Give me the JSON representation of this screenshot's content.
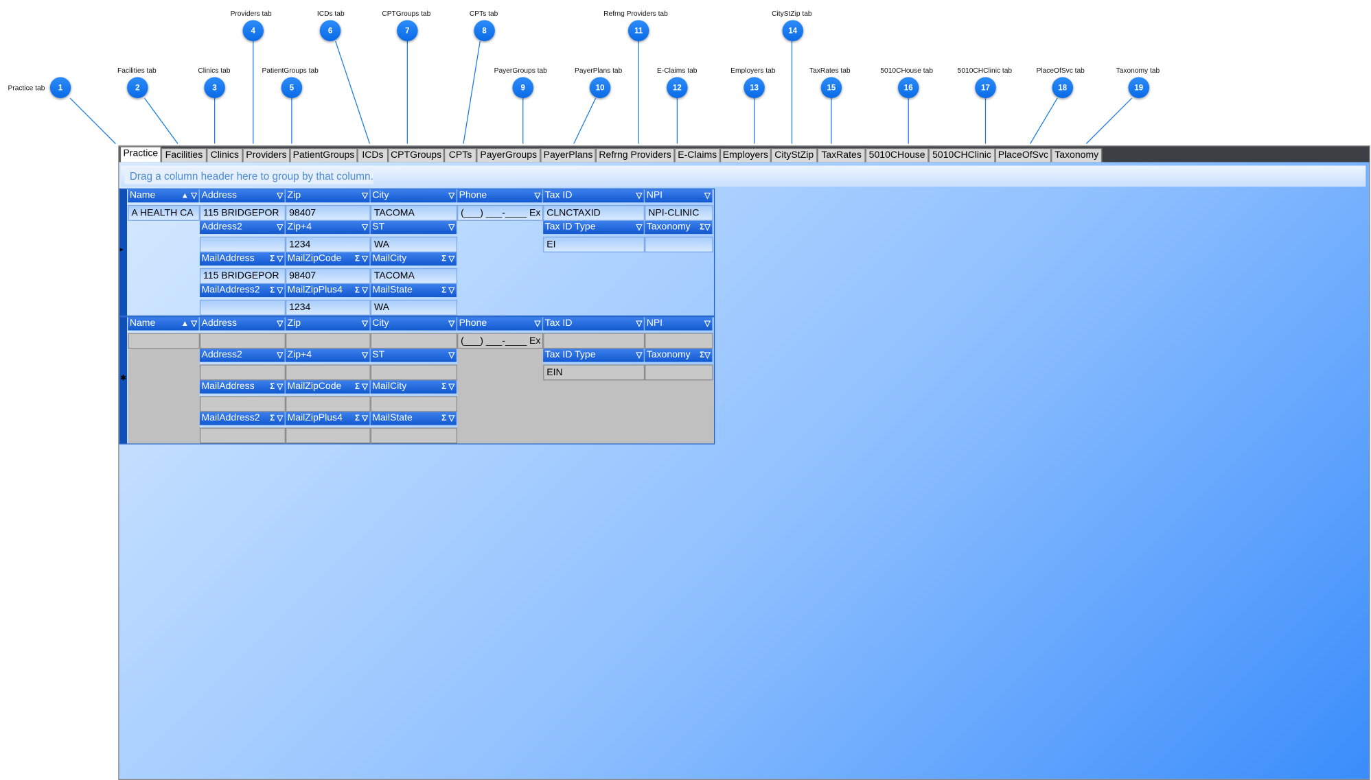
{
  "callouts": [
    {
      "n": "1",
      "label": "Practice tab"
    },
    {
      "n": "2",
      "label": "Facilities tab"
    },
    {
      "n": "3",
      "label": "Clinics tab"
    },
    {
      "n": "4",
      "label": "Providers tab"
    },
    {
      "n": "5",
      "label": "PatientGroups tab"
    },
    {
      "n": "6",
      "label": "ICDs tab"
    },
    {
      "n": "7",
      "label": "CPTGroups tab"
    },
    {
      "n": "8",
      "label": "CPTs tab"
    },
    {
      "n": "9",
      "label": "PayerGroups tab"
    },
    {
      "n": "10",
      "label": "PayerPlans tab"
    },
    {
      "n": "11",
      "label": "Refrng Providers tab"
    },
    {
      "n": "12",
      "label": "E-Claims tab"
    },
    {
      "n": "13",
      "label": "Employers tab"
    },
    {
      "n": "14",
      "label": "CityStZip tab"
    },
    {
      "n": "15",
      "label": "TaxRates tab"
    },
    {
      "n": "16",
      "label": "5010CHouse tab"
    },
    {
      "n": "17",
      "label": "5010CHClinic tab"
    },
    {
      "n": "18",
      "label": "PlaceOfSvc tab"
    },
    {
      "n": "19",
      "label": "Taxonomy tab"
    }
  ],
  "tabs": [
    "Practice",
    "Facilities",
    "Clinics",
    "Providers",
    "PatientGroups",
    "ICDs",
    "CPTGroups",
    "CPTs",
    "PayerGroups",
    "PayerPlans",
    "Refrng Providers",
    "E-Claims",
    "Employers",
    "CityStZip",
    "TaxRates",
    "5010CHouse",
    "5010CHClinic",
    "PlaceOfSvc",
    "Taxonomy"
  ],
  "active_tab": "Practice",
  "group_hint": "Drag a column header here to group by that column.",
  "headers": {
    "name": "Name",
    "address": "Address",
    "zip": "Zip",
    "city": "City",
    "phone": "Phone",
    "taxid": "Tax ID",
    "npi": "NPI",
    "address2": "Address2",
    "zip4": "Zip+4",
    "st": "ST",
    "taxidtype": "Tax ID Type",
    "taxonomy": "Taxonomy",
    "mailaddress": "MailAddress",
    "mailzipcode": "MailZipCode",
    "mailcity": "MailCity",
    "mailaddress2": "MailAddress2",
    "mailzipplus4": "MailZipPlus4",
    "mailstate": "MailState"
  },
  "icons": {
    "sort": "▲",
    "filter": "▽",
    "sum": "Σ",
    "current_row": "▸",
    "new_row": "✱"
  },
  "record": {
    "name": "A HEALTH CA",
    "address": "115 BRIDGEPOR",
    "zip": "98407",
    "city": "TACOMA",
    "phone": "(___) ___-____ Ex",
    "taxid": "CLNCTAXID",
    "npi": "NPI-CLINIC",
    "address2": "",
    "zip4": "1234",
    "st": "WA",
    "taxidtype": "EI",
    "taxonomy": "",
    "mailaddress": "115 BRIDGEPOR",
    "mailzipcode": "98407",
    "mailcity": "TACOMA",
    "mailaddress2": "",
    "mailzipplus4": "1234",
    "mailstate": "WA"
  },
  "new_record": {
    "phone": "(___) ___-____ Ex",
    "taxidtype": "EIN"
  }
}
